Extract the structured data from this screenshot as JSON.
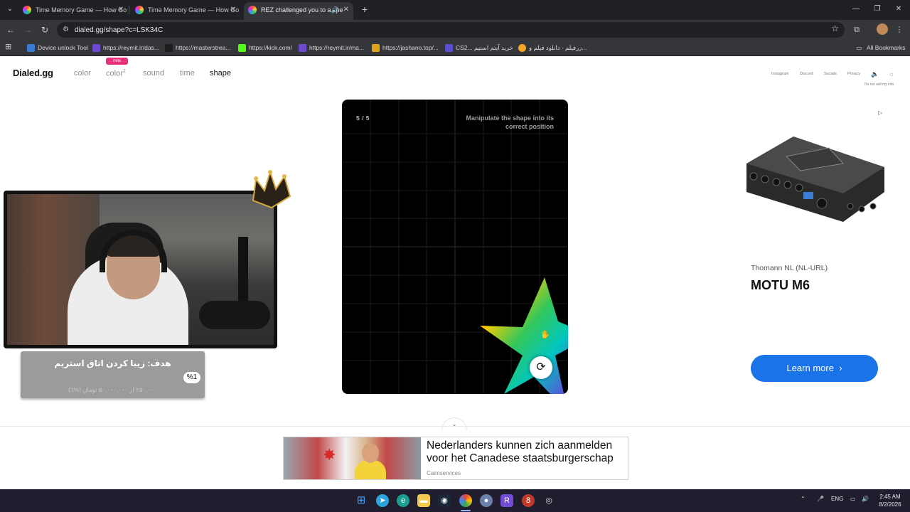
{
  "browser": {
    "tabs": [
      {
        "title": "Time Memory Game — How Go",
        "active": false
      },
      {
        "title": "Time Memory Game — How Go",
        "active": false
      },
      {
        "title": "REZ challenged you to a spe",
        "active": true
      }
    ],
    "url": "dialed.gg/shape?c=LSK34C",
    "bookmarks": [
      "Device unlock Tool",
      "https://reymit.ir/das...",
      "https://masterstrea...",
      "https://kick.com/",
      "https://reymit.ir/ma...",
      "https://jashano.top/...",
      "CS2... خرید آیتم استیم",
      "زرفیلم - دانلود فیلم و..."
    ],
    "all_bookmarks": "All Bookmarks"
  },
  "site": {
    "logo": "Dialed.gg",
    "nav": [
      {
        "label": "color",
        "active": false
      },
      {
        "label": "color",
        "sup": "2",
        "active": false,
        "badge": "new"
      },
      {
        "label": "sound",
        "active": false
      },
      {
        "label": "time",
        "active": false
      },
      {
        "label": "shape",
        "active": true
      }
    ],
    "links": [
      "Instagram",
      "Discord",
      "Socials",
      "Privacy"
    ],
    "do_not_sell": "Do not sell my info"
  },
  "game": {
    "counter": "5 / 5",
    "instruction": "Manipulate the shape into its correct position"
  },
  "stream_overlay": {
    "goal_title": "هدف: زیبا کردن اتاق استریم",
    "goal_percent": "%1",
    "goal_sub": "۲۵۰,۰۰۰ از ۵۰,۰۰۰,۰۰۰ تومان (%1)"
  },
  "right_ad": {
    "advertiser": "Thomann NL (NL-URL)",
    "title": "MOTU M6",
    "cta": "Learn more"
  },
  "bottom_ad": {
    "headline": "Nederlanders kunnen zich aanmelden voor het Canadese staatsburgerschap",
    "source": "Caimservices"
  },
  "taskbar": {
    "lang": "ENG",
    "time": "2:45 AM",
    "date": "8/2/2026"
  },
  "colors": {
    "brand_badge": "#e8317a",
    "cta_blue": "#1a73e8",
    "chrome_dark": "#202124",
    "taskbar": "#1f1d2e"
  }
}
